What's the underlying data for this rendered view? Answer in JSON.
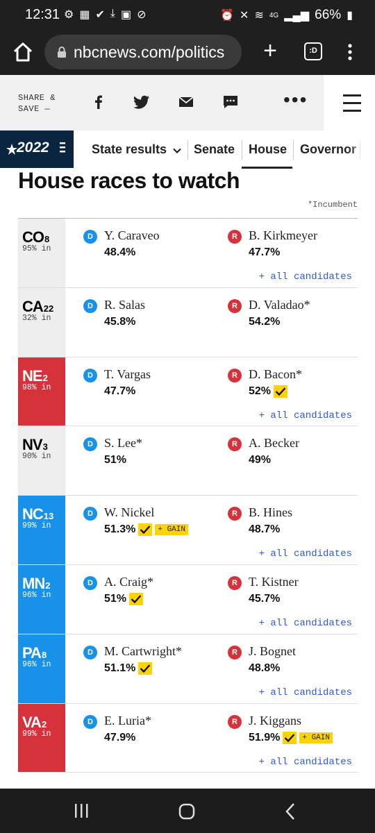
{
  "status_bar": {
    "time": "12:31",
    "battery": "66%",
    "network": "4G"
  },
  "browser": {
    "url": "nbcnews.com/politics",
    "tabs_label": ":D"
  },
  "share": {
    "label_line1": "SHARE &",
    "label_line2": "SAVE —"
  },
  "nav": {
    "logo_text": "2022",
    "items": [
      "State results",
      "Senate",
      "House",
      "Governor"
    ]
  },
  "title": "House races to watch",
  "incumbent_note": "*Incumbent",
  "races": [
    {
      "state": "CO",
      "district": "8",
      "reporting": "95% in",
      "color": "neutral",
      "dem": {
        "name": "Y. Caraveo",
        "pct": "48.4%",
        "winner": false,
        "gain": false
      },
      "rep": {
        "name": "B. Kirkmeyer",
        "pct": "47.7%",
        "winner": false,
        "gain": false
      },
      "all_candidates": "+ all candidates"
    },
    {
      "state": "CA",
      "district": "22",
      "reporting": "32% in",
      "color": "neutral",
      "dem": {
        "name": "R. Salas",
        "pct": "45.8%",
        "winner": false,
        "gain": false
      },
      "rep": {
        "name": "D. Valadao*",
        "pct": "54.2%",
        "winner": false,
        "gain": false
      },
      "all_candidates": ""
    },
    {
      "state": "NE",
      "district": "2",
      "reporting": "98% in",
      "color": "rep",
      "dem": {
        "name": "T. Vargas",
        "pct": "47.7%",
        "winner": false,
        "gain": false
      },
      "rep": {
        "name": "D. Bacon*",
        "pct": "52%",
        "winner": true,
        "gain": false
      },
      "all_candidates": "+ all candidates"
    },
    {
      "state": "NV",
      "district": "3",
      "reporting": "90% in",
      "color": "neutral",
      "dem": {
        "name": "S. Lee*",
        "pct": "51%",
        "winner": false,
        "gain": false
      },
      "rep": {
        "name": "A. Becker",
        "pct": "49%",
        "winner": false,
        "gain": false
      },
      "all_candidates": ""
    },
    {
      "state": "NC",
      "district": "13",
      "reporting": "99% in",
      "color": "dem",
      "dem": {
        "name": "W. Nickel",
        "pct": "51.3%",
        "winner": true,
        "gain": true
      },
      "rep": {
        "name": "B. Hines",
        "pct": "48.7%",
        "winner": false,
        "gain": false
      },
      "all_candidates": "+ all candidates"
    },
    {
      "state": "MN",
      "district": "2",
      "reporting": "96% in",
      "color": "dem",
      "dem": {
        "name": "A. Craig*",
        "pct": "51%",
        "winner": true,
        "gain": false
      },
      "rep": {
        "name": "T. Kistner",
        "pct": "45.7%",
        "winner": false,
        "gain": false
      },
      "all_candidates": "+ all candidates"
    },
    {
      "state": "PA",
      "district": "8",
      "reporting": "96% in",
      "color": "dem",
      "dem": {
        "name": "M. Cartwright*",
        "pct": "51.1%",
        "winner": true,
        "gain": false
      },
      "rep": {
        "name": "J. Bognet",
        "pct": "48.8%",
        "winner": false,
        "gain": false
      },
      "all_candidates": "+ all candidates"
    },
    {
      "state": "VA",
      "district": "2",
      "reporting": "99% in",
      "color": "rep",
      "dem": {
        "name": "E. Luria*",
        "pct": "47.9%",
        "winner": false,
        "gain": false
      },
      "rep": {
        "name": "J. Kiggans",
        "pct": "51.9%",
        "winner": true,
        "gain": true
      },
      "all_candidates": "+ all candidates"
    }
  ],
  "party_labels": {
    "dem": "D",
    "rep": "R"
  },
  "gain_label": "+ GAIN",
  "colors": {
    "dem": "#1891e8",
    "rep": "#d6323c",
    "highlight": "#ffd200",
    "link": "#2b58d6"
  }
}
